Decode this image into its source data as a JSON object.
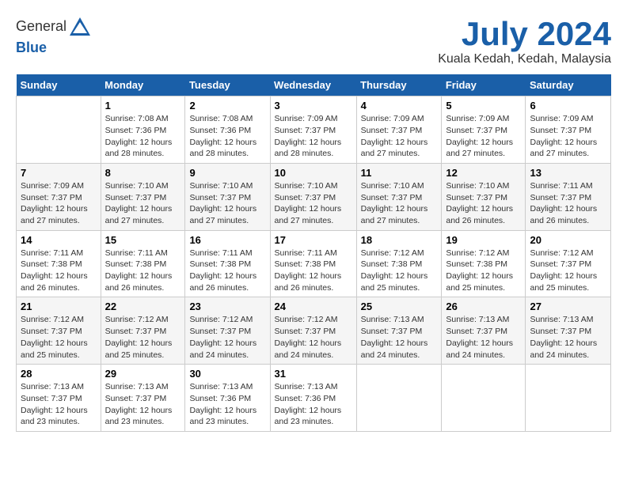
{
  "logo": {
    "text_general": "General",
    "text_blue": "Blue"
  },
  "title": {
    "month_year": "July 2024",
    "location": "Kuala Kedah, Kedah, Malaysia"
  },
  "headers": [
    "Sunday",
    "Monday",
    "Tuesday",
    "Wednesday",
    "Thursday",
    "Friday",
    "Saturday"
  ],
  "weeks": [
    [
      {
        "day": "",
        "sunrise": "",
        "sunset": "",
        "daylight": ""
      },
      {
        "day": "1",
        "sunrise": "Sunrise: 7:08 AM",
        "sunset": "Sunset: 7:36 PM",
        "daylight": "Daylight: 12 hours and 28 minutes."
      },
      {
        "day": "2",
        "sunrise": "Sunrise: 7:08 AM",
        "sunset": "Sunset: 7:36 PM",
        "daylight": "Daylight: 12 hours and 28 minutes."
      },
      {
        "day": "3",
        "sunrise": "Sunrise: 7:09 AM",
        "sunset": "Sunset: 7:37 PM",
        "daylight": "Daylight: 12 hours and 28 minutes."
      },
      {
        "day": "4",
        "sunrise": "Sunrise: 7:09 AM",
        "sunset": "Sunset: 7:37 PM",
        "daylight": "Daylight: 12 hours and 27 minutes."
      },
      {
        "day": "5",
        "sunrise": "Sunrise: 7:09 AM",
        "sunset": "Sunset: 7:37 PM",
        "daylight": "Daylight: 12 hours and 27 minutes."
      },
      {
        "day": "6",
        "sunrise": "Sunrise: 7:09 AM",
        "sunset": "Sunset: 7:37 PM",
        "daylight": "Daylight: 12 hours and 27 minutes."
      }
    ],
    [
      {
        "day": "7",
        "sunrise": "Sunrise: 7:09 AM",
        "sunset": "Sunset: 7:37 PM",
        "daylight": "Daylight: 12 hours and 27 minutes."
      },
      {
        "day": "8",
        "sunrise": "Sunrise: 7:10 AM",
        "sunset": "Sunset: 7:37 PM",
        "daylight": "Daylight: 12 hours and 27 minutes."
      },
      {
        "day": "9",
        "sunrise": "Sunrise: 7:10 AM",
        "sunset": "Sunset: 7:37 PM",
        "daylight": "Daylight: 12 hours and 27 minutes."
      },
      {
        "day": "10",
        "sunrise": "Sunrise: 7:10 AM",
        "sunset": "Sunset: 7:37 PM",
        "daylight": "Daylight: 12 hours and 27 minutes."
      },
      {
        "day": "11",
        "sunrise": "Sunrise: 7:10 AM",
        "sunset": "Sunset: 7:37 PM",
        "daylight": "Daylight: 12 hours and 27 minutes."
      },
      {
        "day": "12",
        "sunrise": "Sunrise: 7:10 AM",
        "sunset": "Sunset: 7:37 PM",
        "daylight": "Daylight: 12 hours and 26 minutes."
      },
      {
        "day": "13",
        "sunrise": "Sunrise: 7:11 AM",
        "sunset": "Sunset: 7:37 PM",
        "daylight": "Daylight: 12 hours and 26 minutes."
      }
    ],
    [
      {
        "day": "14",
        "sunrise": "Sunrise: 7:11 AM",
        "sunset": "Sunset: 7:38 PM",
        "daylight": "Daylight: 12 hours and 26 minutes."
      },
      {
        "day": "15",
        "sunrise": "Sunrise: 7:11 AM",
        "sunset": "Sunset: 7:38 PM",
        "daylight": "Daylight: 12 hours and 26 minutes."
      },
      {
        "day": "16",
        "sunrise": "Sunrise: 7:11 AM",
        "sunset": "Sunset: 7:38 PM",
        "daylight": "Daylight: 12 hours and 26 minutes."
      },
      {
        "day": "17",
        "sunrise": "Sunrise: 7:11 AM",
        "sunset": "Sunset: 7:38 PM",
        "daylight": "Daylight: 12 hours and 26 minutes."
      },
      {
        "day": "18",
        "sunrise": "Sunrise: 7:12 AM",
        "sunset": "Sunset: 7:38 PM",
        "daylight": "Daylight: 12 hours and 25 minutes."
      },
      {
        "day": "19",
        "sunrise": "Sunrise: 7:12 AM",
        "sunset": "Sunset: 7:38 PM",
        "daylight": "Daylight: 12 hours and 25 minutes."
      },
      {
        "day": "20",
        "sunrise": "Sunrise: 7:12 AM",
        "sunset": "Sunset: 7:37 PM",
        "daylight": "Daylight: 12 hours and 25 minutes."
      }
    ],
    [
      {
        "day": "21",
        "sunrise": "Sunrise: 7:12 AM",
        "sunset": "Sunset: 7:37 PM",
        "daylight": "Daylight: 12 hours and 25 minutes."
      },
      {
        "day": "22",
        "sunrise": "Sunrise: 7:12 AM",
        "sunset": "Sunset: 7:37 PM",
        "daylight": "Daylight: 12 hours and 25 minutes."
      },
      {
        "day": "23",
        "sunrise": "Sunrise: 7:12 AM",
        "sunset": "Sunset: 7:37 PM",
        "daylight": "Daylight: 12 hours and 24 minutes."
      },
      {
        "day": "24",
        "sunrise": "Sunrise: 7:12 AM",
        "sunset": "Sunset: 7:37 PM",
        "daylight": "Daylight: 12 hours and 24 minutes."
      },
      {
        "day": "25",
        "sunrise": "Sunrise: 7:13 AM",
        "sunset": "Sunset: 7:37 PM",
        "daylight": "Daylight: 12 hours and 24 minutes."
      },
      {
        "day": "26",
        "sunrise": "Sunrise: 7:13 AM",
        "sunset": "Sunset: 7:37 PM",
        "daylight": "Daylight: 12 hours and 24 minutes."
      },
      {
        "day": "27",
        "sunrise": "Sunrise: 7:13 AM",
        "sunset": "Sunset: 7:37 PM",
        "daylight": "Daylight: 12 hours and 24 minutes."
      }
    ],
    [
      {
        "day": "28",
        "sunrise": "Sunrise: 7:13 AM",
        "sunset": "Sunset: 7:37 PM",
        "daylight": "Daylight: 12 hours and 23 minutes."
      },
      {
        "day": "29",
        "sunrise": "Sunrise: 7:13 AM",
        "sunset": "Sunset: 7:37 PM",
        "daylight": "Daylight: 12 hours and 23 minutes."
      },
      {
        "day": "30",
        "sunrise": "Sunrise: 7:13 AM",
        "sunset": "Sunset: 7:36 PM",
        "daylight": "Daylight: 12 hours and 23 minutes."
      },
      {
        "day": "31",
        "sunrise": "Sunrise: 7:13 AM",
        "sunset": "Sunset: 7:36 PM",
        "daylight": "Daylight: 12 hours and 23 minutes."
      },
      {
        "day": "",
        "sunrise": "",
        "sunset": "",
        "daylight": ""
      },
      {
        "day": "",
        "sunrise": "",
        "sunset": "",
        "daylight": ""
      },
      {
        "day": "",
        "sunrise": "",
        "sunset": "",
        "daylight": ""
      }
    ]
  ]
}
